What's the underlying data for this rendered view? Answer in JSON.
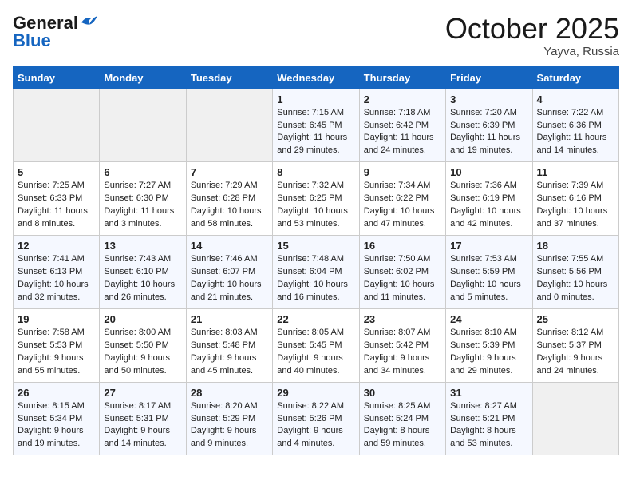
{
  "header": {
    "logo_line1": "General",
    "logo_line2": "Blue",
    "month": "October 2025",
    "location": "Yayva, Russia"
  },
  "days_of_week": [
    "Sunday",
    "Monday",
    "Tuesday",
    "Wednesday",
    "Thursday",
    "Friday",
    "Saturday"
  ],
  "weeks": [
    [
      {
        "day": "",
        "info": ""
      },
      {
        "day": "",
        "info": ""
      },
      {
        "day": "",
        "info": ""
      },
      {
        "day": "1",
        "info": "Sunrise: 7:15 AM\nSunset: 6:45 PM\nDaylight: 11 hours\nand 29 minutes."
      },
      {
        "day": "2",
        "info": "Sunrise: 7:18 AM\nSunset: 6:42 PM\nDaylight: 11 hours\nand 24 minutes."
      },
      {
        "day": "3",
        "info": "Sunrise: 7:20 AM\nSunset: 6:39 PM\nDaylight: 11 hours\nand 19 minutes."
      },
      {
        "day": "4",
        "info": "Sunrise: 7:22 AM\nSunset: 6:36 PM\nDaylight: 11 hours\nand 14 minutes."
      }
    ],
    [
      {
        "day": "5",
        "info": "Sunrise: 7:25 AM\nSunset: 6:33 PM\nDaylight: 11 hours\nand 8 minutes."
      },
      {
        "day": "6",
        "info": "Sunrise: 7:27 AM\nSunset: 6:30 PM\nDaylight: 11 hours\nand 3 minutes."
      },
      {
        "day": "7",
        "info": "Sunrise: 7:29 AM\nSunset: 6:28 PM\nDaylight: 10 hours\nand 58 minutes."
      },
      {
        "day": "8",
        "info": "Sunrise: 7:32 AM\nSunset: 6:25 PM\nDaylight: 10 hours\nand 53 minutes."
      },
      {
        "day": "9",
        "info": "Sunrise: 7:34 AM\nSunset: 6:22 PM\nDaylight: 10 hours\nand 47 minutes."
      },
      {
        "day": "10",
        "info": "Sunrise: 7:36 AM\nSunset: 6:19 PM\nDaylight: 10 hours\nand 42 minutes."
      },
      {
        "day": "11",
        "info": "Sunrise: 7:39 AM\nSunset: 6:16 PM\nDaylight: 10 hours\nand 37 minutes."
      }
    ],
    [
      {
        "day": "12",
        "info": "Sunrise: 7:41 AM\nSunset: 6:13 PM\nDaylight: 10 hours\nand 32 minutes."
      },
      {
        "day": "13",
        "info": "Sunrise: 7:43 AM\nSunset: 6:10 PM\nDaylight: 10 hours\nand 26 minutes."
      },
      {
        "day": "14",
        "info": "Sunrise: 7:46 AM\nSunset: 6:07 PM\nDaylight: 10 hours\nand 21 minutes."
      },
      {
        "day": "15",
        "info": "Sunrise: 7:48 AM\nSunset: 6:04 PM\nDaylight: 10 hours\nand 16 minutes."
      },
      {
        "day": "16",
        "info": "Sunrise: 7:50 AM\nSunset: 6:02 PM\nDaylight: 10 hours\nand 11 minutes."
      },
      {
        "day": "17",
        "info": "Sunrise: 7:53 AM\nSunset: 5:59 PM\nDaylight: 10 hours\nand 5 minutes."
      },
      {
        "day": "18",
        "info": "Sunrise: 7:55 AM\nSunset: 5:56 PM\nDaylight: 10 hours\nand 0 minutes."
      }
    ],
    [
      {
        "day": "19",
        "info": "Sunrise: 7:58 AM\nSunset: 5:53 PM\nDaylight: 9 hours\nand 55 minutes."
      },
      {
        "day": "20",
        "info": "Sunrise: 8:00 AM\nSunset: 5:50 PM\nDaylight: 9 hours\nand 50 minutes."
      },
      {
        "day": "21",
        "info": "Sunrise: 8:03 AM\nSunset: 5:48 PM\nDaylight: 9 hours\nand 45 minutes."
      },
      {
        "day": "22",
        "info": "Sunrise: 8:05 AM\nSunset: 5:45 PM\nDaylight: 9 hours\nand 40 minutes."
      },
      {
        "day": "23",
        "info": "Sunrise: 8:07 AM\nSunset: 5:42 PM\nDaylight: 9 hours\nand 34 minutes."
      },
      {
        "day": "24",
        "info": "Sunrise: 8:10 AM\nSunset: 5:39 PM\nDaylight: 9 hours\nand 29 minutes."
      },
      {
        "day": "25",
        "info": "Sunrise: 8:12 AM\nSunset: 5:37 PM\nDaylight: 9 hours\nand 24 minutes."
      }
    ],
    [
      {
        "day": "26",
        "info": "Sunrise: 8:15 AM\nSunset: 5:34 PM\nDaylight: 9 hours\nand 19 minutes."
      },
      {
        "day": "27",
        "info": "Sunrise: 8:17 AM\nSunset: 5:31 PM\nDaylight: 9 hours\nand 14 minutes."
      },
      {
        "day": "28",
        "info": "Sunrise: 8:20 AM\nSunset: 5:29 PM\nDaylight: 9 hours\nand 9 minutes."
      },
      {
        "day": "29",
        "info": "Sunrise: 8:22 AM\nSunset: 5:26 PM\nDaylight: 9 hours\nand 4 minutes."
      },
      {
        "day": "30",
        "info": "Sunrise: 8:25 AM\nSunset: 5:24 PM\nDaylight: 8 hours\nand 59 minutes."
      },
      {
        "day": "31",
        "info": "Sunrise: 8:27 AM\nSunset: 5:21 PM\nDaylight: 8 hours\nand 53 minutes."
      },
      {
        "day": "",
        "info": ""
      }
    ]
  ]
}
